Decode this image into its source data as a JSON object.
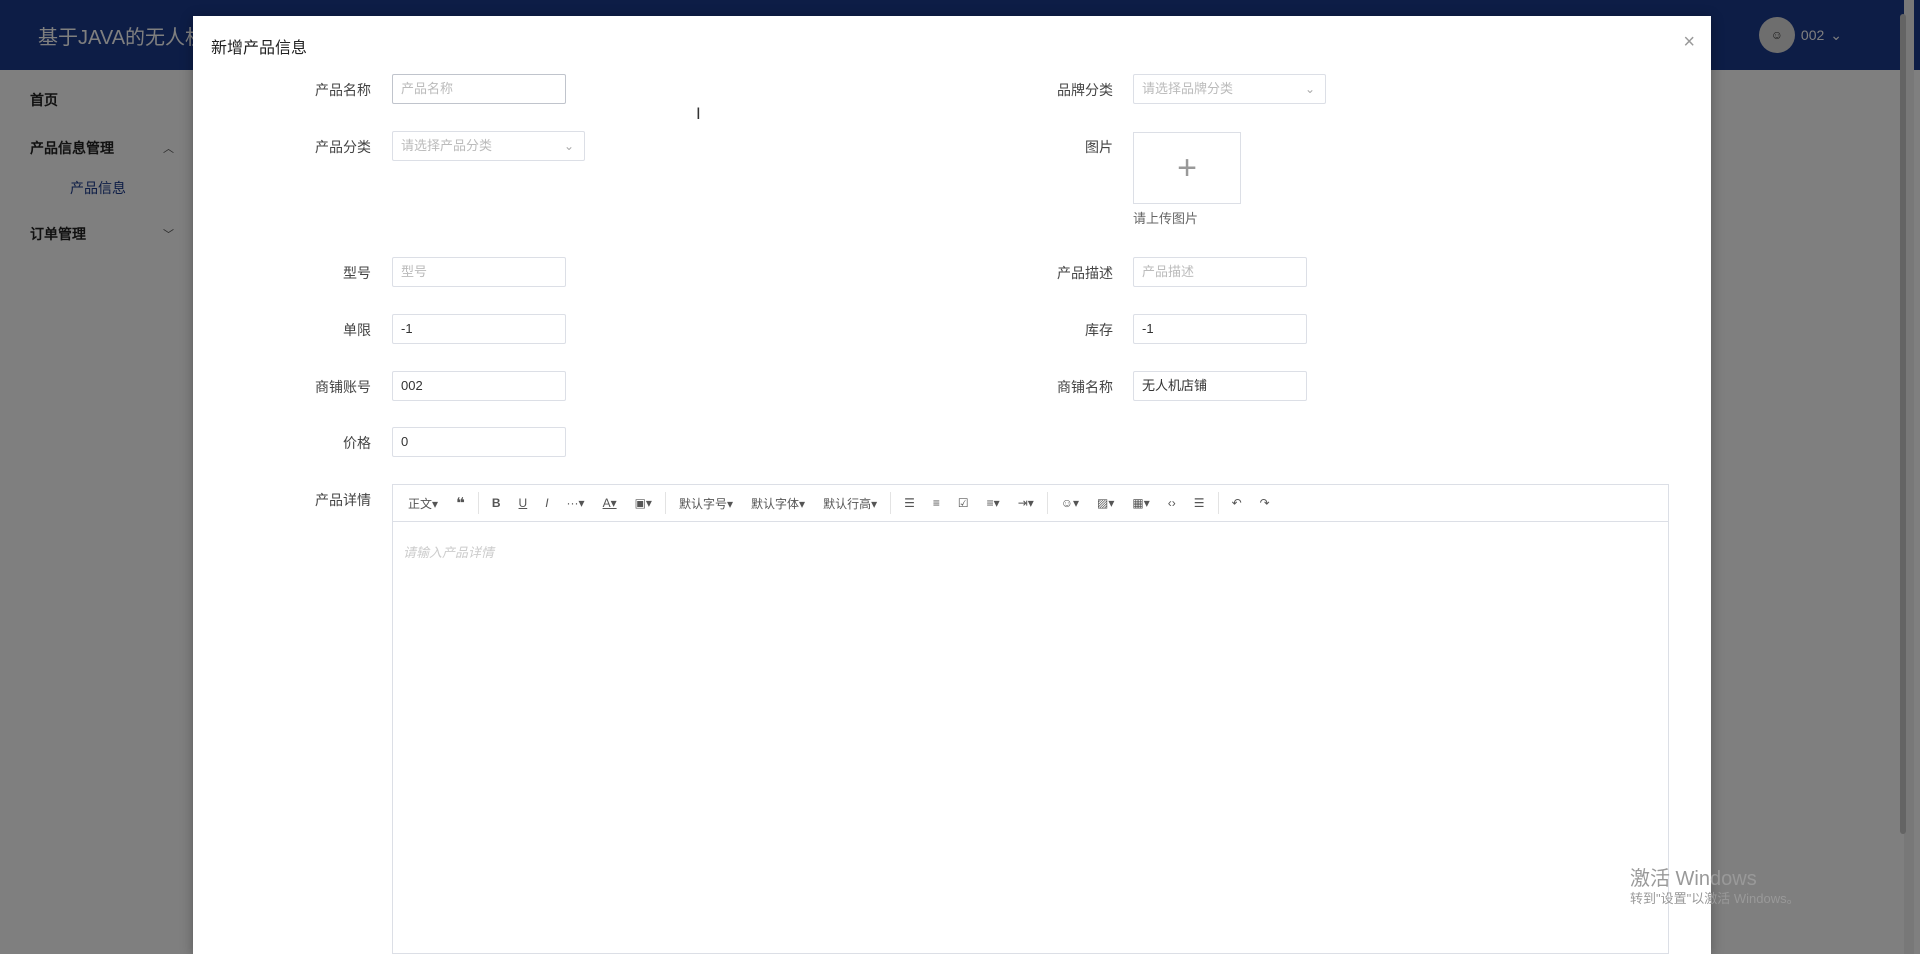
{
  "header": {
    "app_title": "基于JAVA的无人机",
    "username": "002",
    "avatar_icon": "avatar-icon",
    "chevron_icon": "chevron-down-icon"
  },
  "sidebar": {
    "home": "首页",
    "product_mgmt": "产品信息管理",
    "product_info": "产品信息",
    "order_mgmt": "订单管理"
  },
  "dialog": {
    "title": "新增产品信息",
    "close": "×",
    "fields": {
      "product_name": {
        "label": "产品名称",
        "placeholder": "产品名称"
      },
      "brand": {
        "label": "品牌分类",
        "placeholder": "请选择品牌分类"
      },
      "category": {
        "label": "产品分类",
        "placeholder": "请选择产品分类"
      },
      "image": {
        "label": "图片",
        "hint": "请上传图片"
      },
      "model": {
        "label": "型号",
        "placeholder": "型号"
      },
      "description": {
        "label": "产品描述",
        "placeholder": "产品描述"
      },
      "limit": {
        "label": "单限",
        "value": "-1"
      },
      "stock": {
        "label": "库存",
        "value": "-1"
      },
      "shop_account": {
        "label": "商铺账号",
        "value": "002"
      },
      "shop_name": {
        "label": "商铺名称",
        "value": "无人机店铺"
      },
      "price": {
        "label": "价格",
        "value": "0"
      },
      "details": {
        "label": "产品详情",
        "placeholder": "请输入产品详情"
      }
    },
    "toolbar": {
      "paragraph": "正文",
      "font_size": "默认字号",
      "font_family": "默认字体",
      "line_height": "默认行高"
    }
  },
  "watermark": {
    "line1": "激活 Windows",
    "line2": "转到\"设置\"以激活 Windows。"
  }
}
